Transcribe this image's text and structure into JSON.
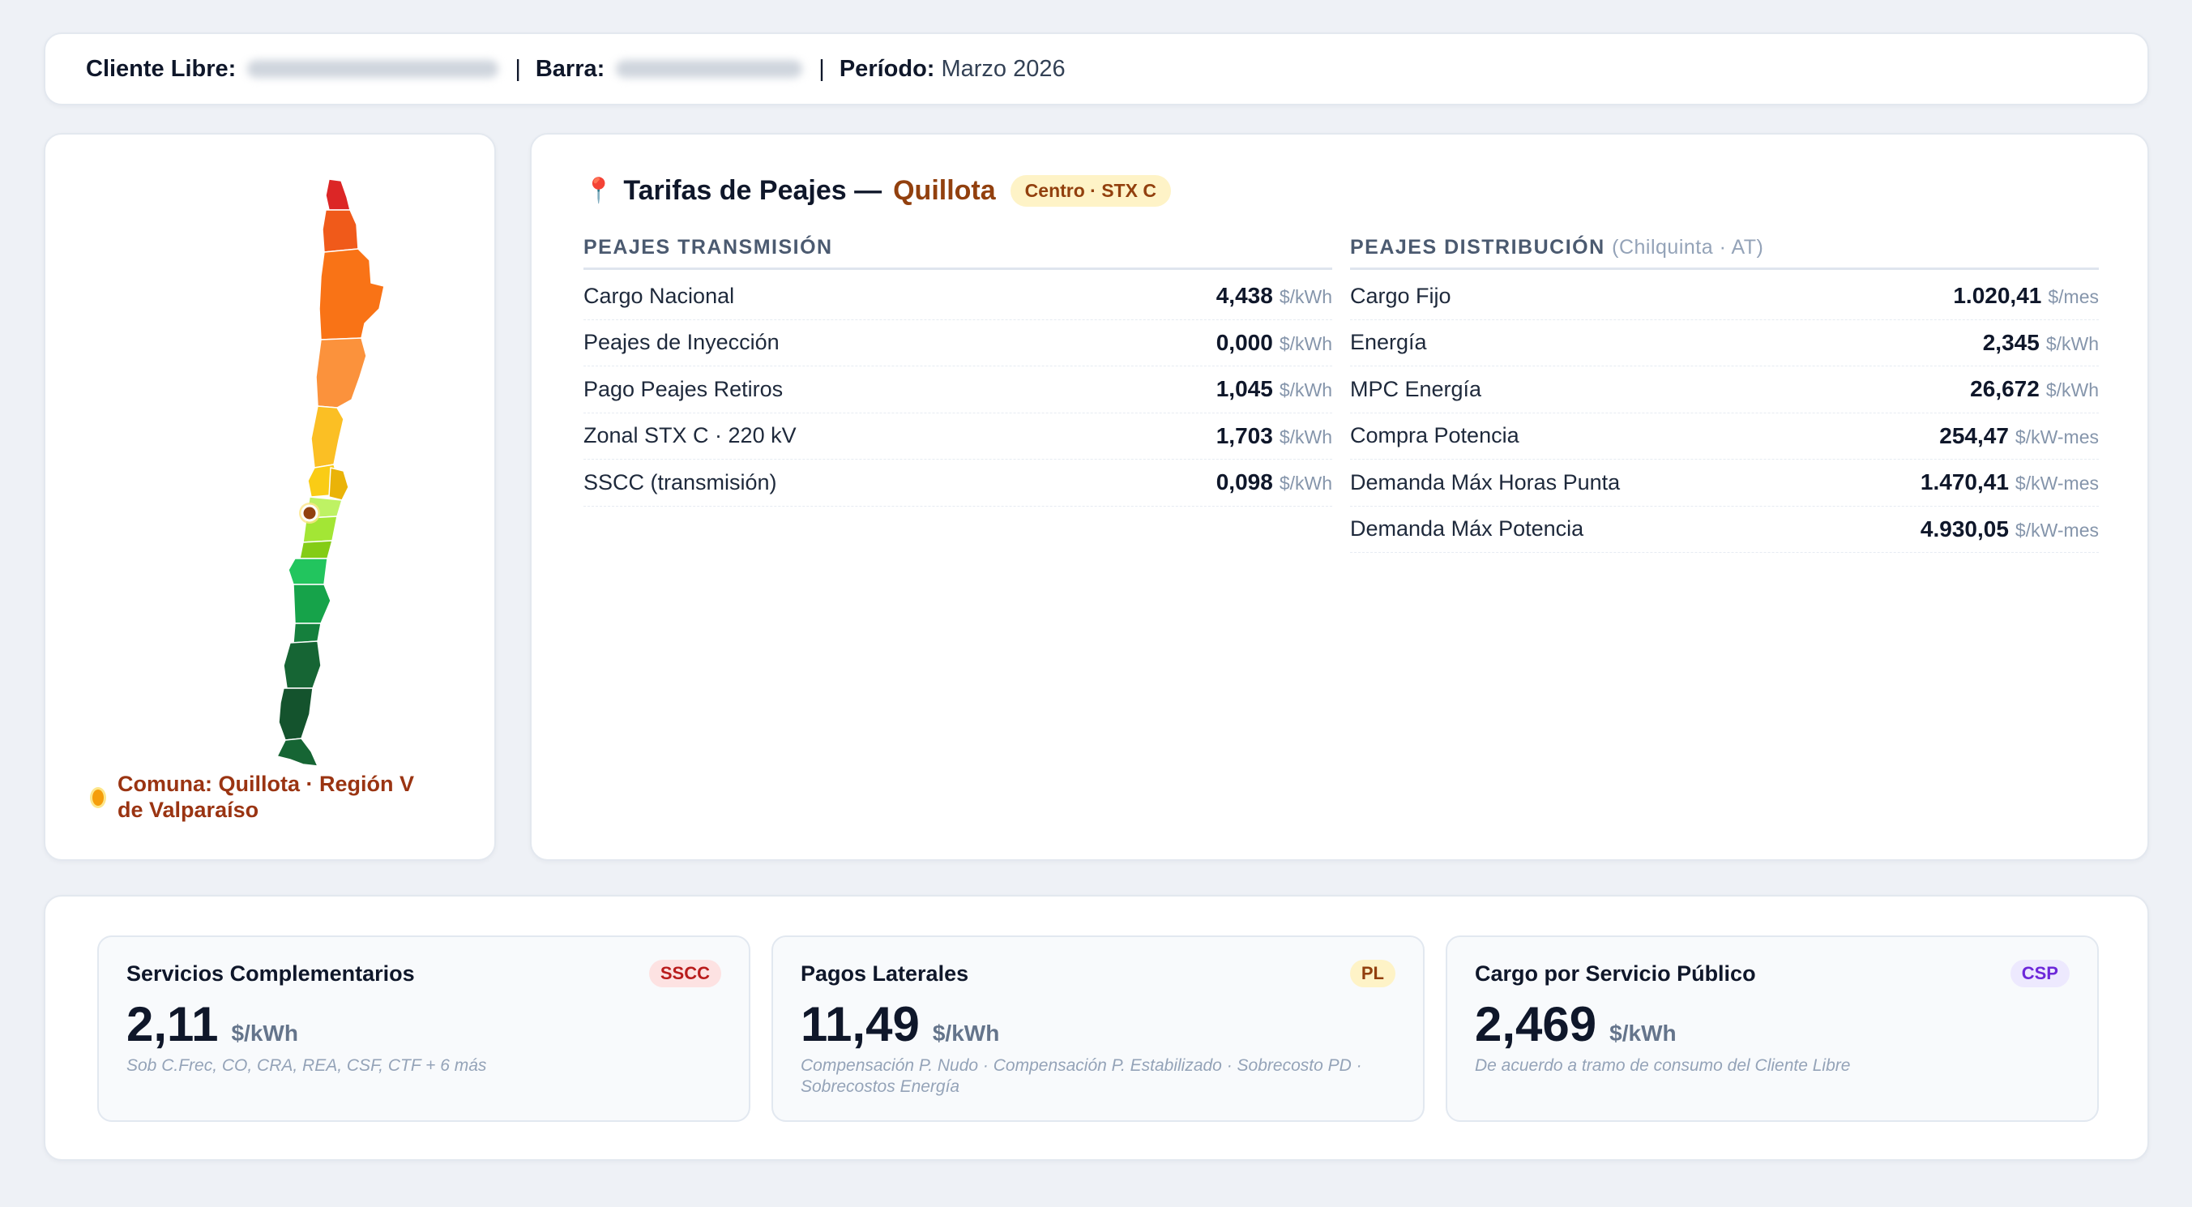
{
  "header": {
    "cliente_label": "Cliente Libre:",
    "barra_label": "Barra:",
    "periodo_label": "Período:",
    "periodo_value": "Marzo 2026",
    "separator": "|"
  },
  "map": {
    "comuna_text": "Comuna: Quillota · Región V de Valparaíso",
    "marker_color": "#f59e0b"
  },
  "tarifas": {
    "pin_icon": "📍",
    "title": "Tarifas de Peajes —",
    "city": "Quillota",
    "tag": "Centro · STX C",
    "transmision": {
      "heading": "PEAJES TRANSMISIÓN",
      "rows": [
        {
          "name": "Cargo Nacional",
          "value": "4,438",
          "unit": "$/kWh"
        },
        {
          "name": "Peajes de Inyección",
          "value": "0,000",
          "unit": "$/kWh"
        },
        {
          "name": "Pago Peajes Retiros",
          "value": "1,045",
          "unit": "$/kWh"
        },
        {
          "name": "Zonal STX C · 220 kV",
          "value": "1,703",
          "unit": "$/kWh"
        },
        {
          "name": "SSCC (transmisión)",
          "value": "0,098",
          "unit": "$/kWh"
        }
      ]
    },
    "distribucion": {
      "heading": "PEAJES DISTRIBUCIÓN",
      "sub": "(Chilquinta · AT)",
      "rows": [
        {
          "name": "Cargo Fijo",
          "value": "1.020,41",
          "unit": "$/mes"
        },
        {
          "name": "Energía",
          "value": "2,345",
          "unit": "$/kWh"
        },
        {
          "name": "MPC Energía",
          "value": "26,672",
          "unit": "$/kWh"
        },
        {
          "name": "Compra Potencia",
          "value": "254,47",
          "unit": "$/kW-mes"
        },
        {
          "name": "Demanda Máx Horas Punta",
          "value": "1.470,41",
          "unit": "$/kW-mes"
        },
        {
          "name": "Demanda Máx Potencia",
          "value": "4.930,05",
          "unit": "$/kW-mes"
        }
      ]
    }
  },
  "cards": [
    {
      "title": "Servicios Complementarios",
      "badge": "SSCC",
      "badge_bg": "#fde2e2",
      "badge_fg": "#b91c1c",
      "value": "2,11",
      "unit": "$/kWh",
      "note": "Sob C.Frec, CO, CRA, REA, CSF, CTF + 6 más"
    },
    {
      "title": "Pagos Laterales",
      "badge": "PL",
      "badge_bg": "#fef3c7",
      "badge_fg": "#92400e",
      "value": "11,49",
      "unit": "$/kWh",
      "note": "Compensación P. Nudo · Compensación P. Estabilizado · Sobrecosto PD · Sobrecostos Energía"
    },
    {
      "title": "Cargo por Servicio Público",
      "badge": "CSP",
      "badge_bg": "#ede9fe",
      "badge_fg": "#6d28d9",
      "value": "2,469",
      "unit": "$/kWh",
      "note": "De acuerdo a tramo de consumo del Cliente Libre"
    }
  ]
}
